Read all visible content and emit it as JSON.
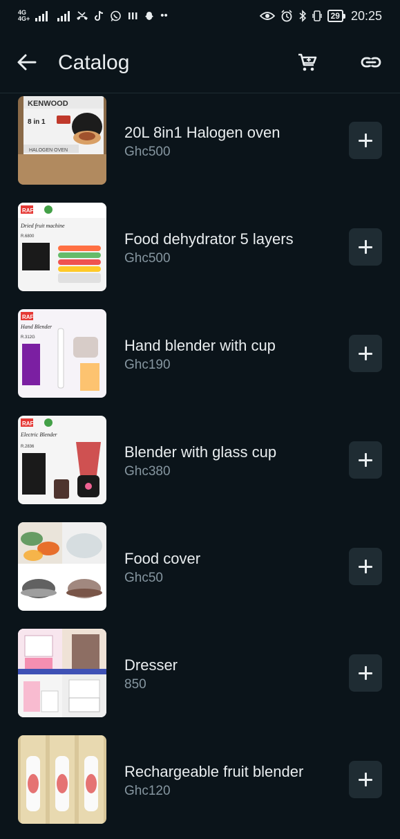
{
  "status_bar": {
    "network": "4G",
    "network_sub": "4G+",
    "battery": "29",
    "time": "20:25",
    "left_icons": [
      "signal-icon",
      "signal-icon",
      "missed-call-icon",
      "tiktok-icon",
      "whatsapp-icon",
      "app-icon",
      "snapchat-icon",
      "more-dots-icon"
    ],
    "right_icons": [
      "eye-icon",
      "alarm-icon",
      "bluetooth-icon",
      "vibrate-icon"
    ]
  },
  "app_bar": {
    "title": "Catalog",
    "back_icon": "arrow-left-icon",
    "cart_icon": "cart-icon",
    "link_icon": "link-icon"
  },
  "colors": {
    "background": "#0b141a",
    "primary_text": "#e9edef",
    "secondary_text": "#8696a0",
    "button_bg": "#1f2c33"
  },
  "catalog": {
    "items": [
      {
        "name": "20L 8in1 Halogen oven",
        "price": "Ghc500",
        "thumb_brand": "KENWOOD",
        "thumb_text": "HALOGEN OVEN",
        "thumb_badge": "8 in 1"
      },
      {
        "name": "Food dehydrator 5 layers",
        "price": "Ghc500",
        "thumb_brand": "RAF",
        "thumb_text": "Dried fruit machine",
        "thumb_model": "R.6800"
      },
      {
        "name": "Hand blender with cup",
        "price": "Ghc190",
        "thumb_brand": "RAF",
        "thumb_text": "Hand Blender",
        "thumb_model": "R.312G"
      },
      {
        "name": "Blender with glass cup",
        "price": "Ghc380",
        "thumb_brand": "RAF",
        "thumb_text": "Electric Blender",
        "thumb_model": "R.2836"
      },
      {
        "name": "Food cover",
        "price": "Ghc50"
      },
      {
        "name": "Dresser",
        "price": "850"
      },
      {
        "name": "Rechargeable fruit blender",
        "price": "Ghc120"
      }
    ],
    "add_icon": "plus-icon"
  }
}
